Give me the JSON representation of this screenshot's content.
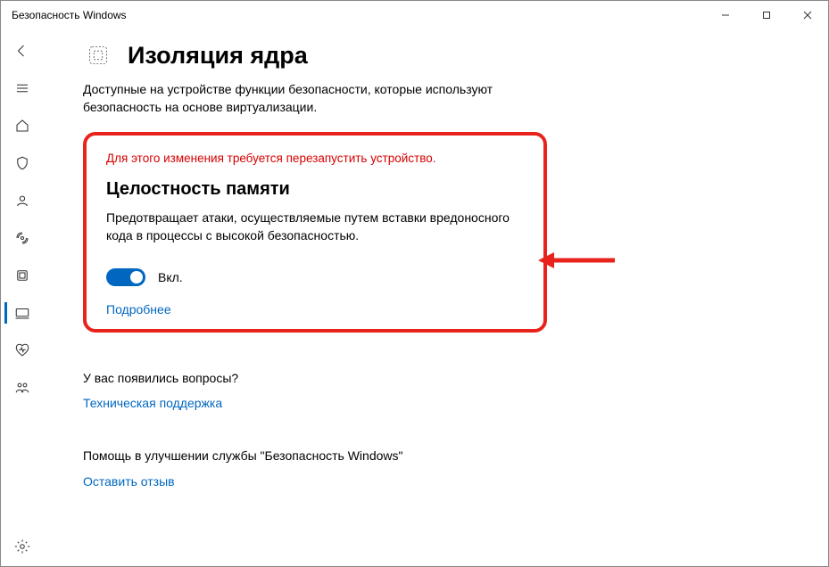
{
  "window": {
    "title": "Безопасность Windows"
  },
  "page": {
    "title": "Изоляция ядра",
    "description": "Доступные на устройстве функции безопасности, которые используют безопасность на основе виртуализации."
  },
  "memory": {
    "restart_msg": "Для этого изменения требуется перезапустить устройство.",
    "title": "Целостность памяти",
    "description": "Предотвращает атаки, осуществляемые путем вставки вредоносного кода в процессы с высокой безопасностью.",
    "toggle_label": "Вкл.",
    "learn_more": "Подробнее"
  },
  "help": {
    "questions_heading": "У вас появились вопросы?",
    "support_link": "Техническая поддержка",
    "improve_heading": "Помощь в улучшении службы \"Безопасность Windows\"",
    "feedback_link": "Оставить отзыв"
  }
}
